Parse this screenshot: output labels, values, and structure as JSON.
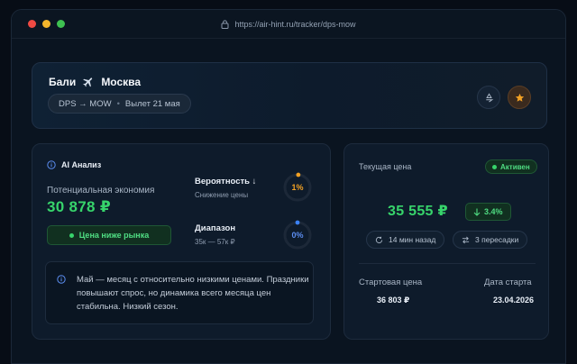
{
  "browser": {
    "url": "https://air-hint.ru/tracker/dps-mow"
  },
  "header": {
    "origin_city": "Бали",
    "destination_city": "Москва",
    "route_code": "DPS → MOW",
    "departure": "Вылет 21 мая"
  },
  "analysis": {
    "title": "AI Анализ",
    "savings_label": "Потенциальная экономия",
    "savings_value": "30 878 ₽",
    "market_badge": "Цена ниже рынка",
    "probability": {
      "label": "Вероятность ↓",
      "sub": "Снижение цены",
      "value_text": "1%",
      "value": 1,
      "color": "#f2a124"
    },
    "range": {
      "label": "Диапазон",
      "sub": "35к — 57к ₽",
      "value_text": "0%",
      "value": 0,
      "color": "#3b82f6"
    },
    "info_text": "Май — месяц с относительно низкими ценами. Праздники повышают спрос, но динамика всего месяца цен стабильна. Низкий сезон."
  },
  "price": {
    "current_label": "Текущая цена",
    "status_badge": "Активен",
    "current_value": "35 555 ₽",
    "change": "3.4%",
    "updated": "14 мин назад",
    "stops": "3 пересадки",
    "start_price_label": "Стартовая цена",
    "start_price_value": "36 803 ₽",
    "start_date_label": "Дата старта",
    "start_date_value": "23.04.2026"
  },
  "colors": {
    "accent_green": "#37d46b",
    "accent_orange": "#f2a124",
    "accent_blue": "#3b82f6",
    "background": "#0a1420"
  }
}
